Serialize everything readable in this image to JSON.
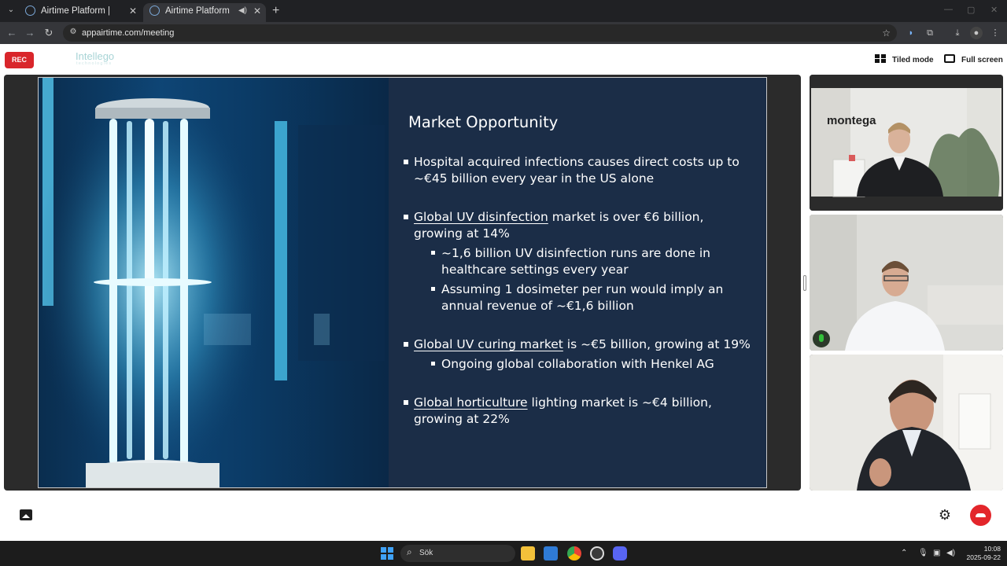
{
  "browser": {
    "tabs": [
      {
        "title": "Airtime Platform | Investor",
        "active": false
      },
      {
        "title": "Airtime Platform",
        "active": true
      }
    ],
    "url": "appairtime.com/meeting"
  },
  "app": {
    "rec_label": "REC",
    "logo": "Intellego",
    "logo_sub": "technologies",
    "tiled_mode_label": "Tiled mode",
    "full_screen_label": "Full screen"
  },
  "slide": {
    "title": "Market Opportunity",
    "bullets": {
      "b1_line1": "Hospital acquired infections causes direct costs up to",
      "b1_line2": "~€45 billion every year in the US alone",
      "b2_link": "Global UV disinfection",
      "b2_rest": " market is over €6 billion,",
      "b2_line2": "growing at 14%",
      "b2_s1_line1": "~1,6 billion UV disinfection runs are done in",
      "b2_s1_line2": "healthcare settings every year",
      "b2_s2_line1": "Assuming 1 dosimeter per run would imply an",
      "b2_s2_line2": "annual revenue of ~€1,6 billion",
      "b3_link": "Global UV curing market",
      "b3_rest": " is ~€5 billion, growing at 19%",
      "b3_s1": "Ongoing global collaboration with Henkel AG",
      "b4_link": "Global horticulture",
      "b4_rest": " lighting market is ~€4 billion,",
      "b4_line2": "growing at 22%"
    }
  },
  "participants": {
    "p1_wall_text": "montega"
  },
  "taskbar": {
    "search_label": "Sök",
    "time": "10:08",
    "date": "2025-09-22"
  }
}
